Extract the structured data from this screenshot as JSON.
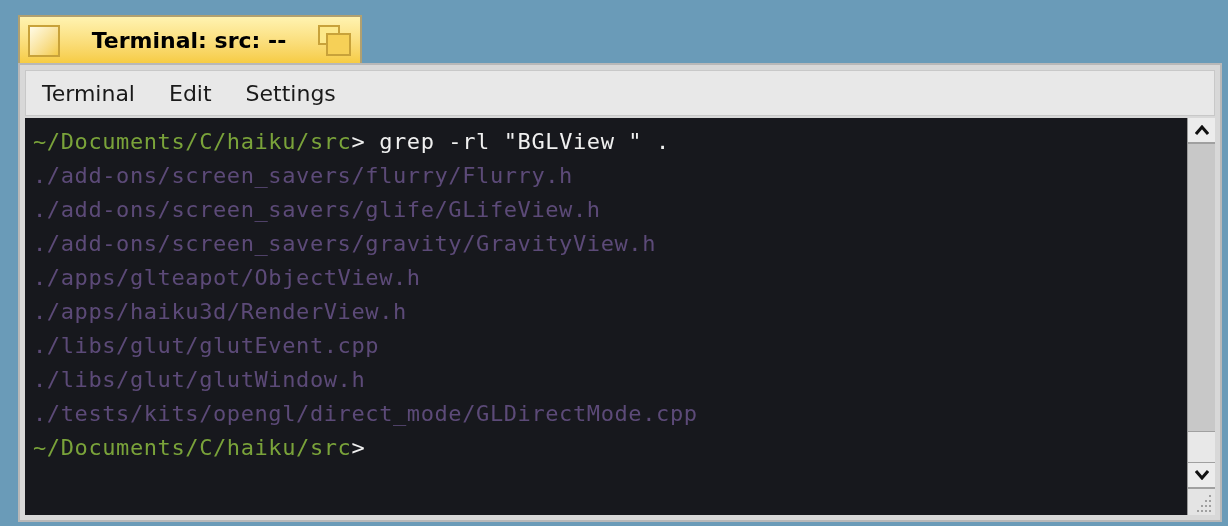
{
  "window": {
    "title": "Terminal: src: --"
  },
  "menu_bar": [
    "Terminal",
    "Edit",
    "Settings"
  ],
  "terminal_lines": [
    {
      "kind": "prompt",
      "path": "~/Documents/C/haiku/src",
      "symbol": ">",
      "command": "grep -rl \"BGLView \" ."
    },
    {
      "kind": "output",
      "text": "./add-ons/screen_savers/flurry/Flurry.h"
    },
    {
      "kind": "output",
      "text": "./add-ons/screen_savers/glife/GLifeView.h"
    },
    {
      "kind": "output",
      "text": "./add-ons/screen_savers/gravity/GravityView.h"
    },
    {
      "kind": "output",
      "text": "./apps/glteapot/ObjectView.h"
    },
    {
      "kind": "output",
      "text": "./apps/haiku3d/RenderView.h"
    },
    {
      "kind": "output",
      "text": "./libs/glut/glutEvent.cpp"
    },
    {
      "kind": "output",
      "text": "./libs/glut/glutWindow.h"
    },
    {
      "kind": "output",
      "text": "./tests/kits/opengl/direct_mode/GLDirectMode.cpp"
    },
    {
      "kind": "prompt",
      "path": "~/Documents/C/haiku/src",
      "symbol": ">"
    }
  ]
}
